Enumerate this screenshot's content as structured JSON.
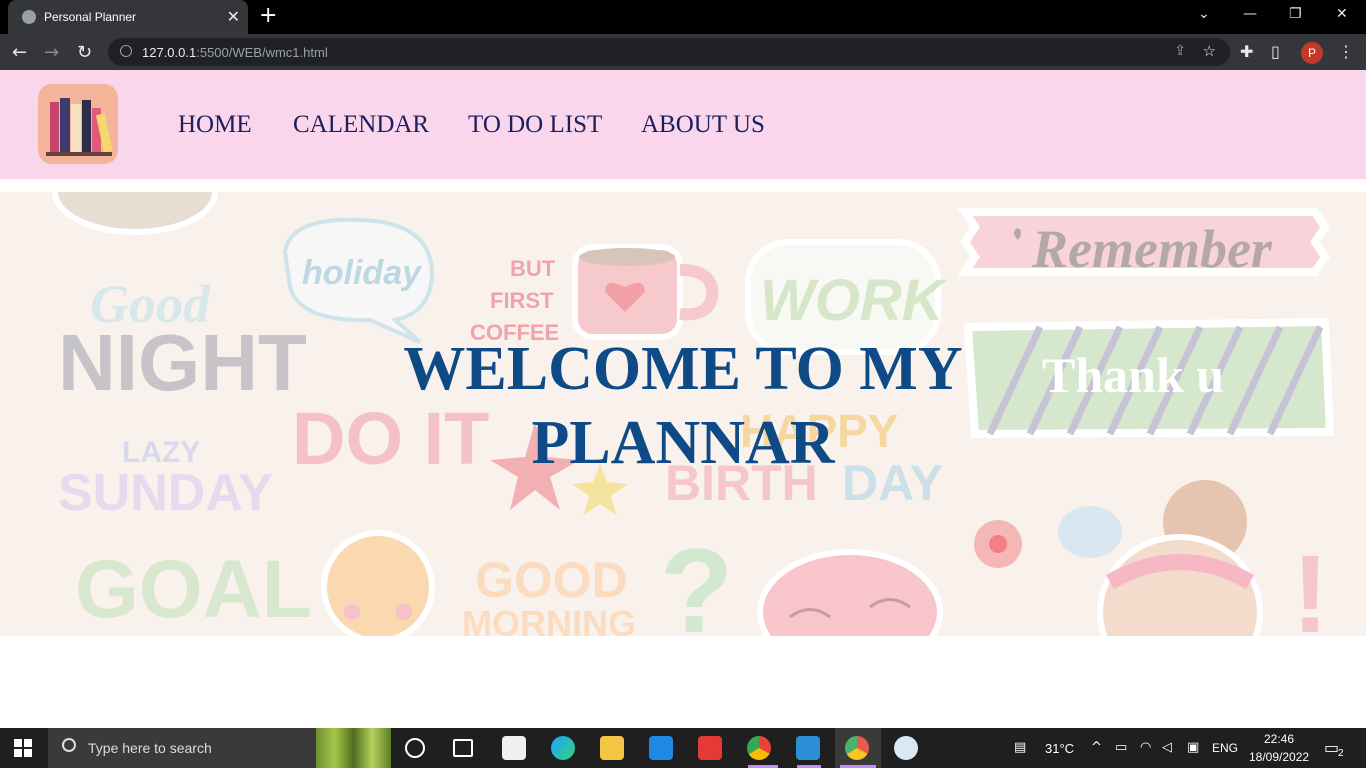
{
  "browser": {
    "tab_title": "Personal Planner",
    "tab_close": "✕",
    "new_tab": "+",
    "url_host": "127.0.0.1",
    "url_path": ":5500/WEB/wmc1.html",
    "profile_initial": "P",
    "window_controls": [
      "⌄",
      "—",
      "❐",
      "✕"
    ]
  },
  "site": {
    "nav": [
      "HOME",
      "CALENDAR",
      "TO DO LIST",
      "ABOUT US"
    ],
    "hero_line1": "WELCOME TO MY",
    "hero_line2": "PLANNAR",
    "stickers": [
      "Good",
      "NIGHT",
      "holiday",
      "BUT",
      "FIRST",
      "COFFEE",
      "WORK",
      "Remember",
      "Thank u",
      "LAZY",
      "SUNDAY",
      "DO IT",
      "HAPPY",
      "BIRTH",
      "DAY",
      "GOAL",
      "GOOD",
      "MORNING",
      "?",
      "!"
    ]
  },
  "taskbar": {
    "search_placeholder": "Type here to search",
    "weather": "31°C",
    "language": "ENG",
    "time": "22:46",
    "date": "18/09/2022",
    "notifications": "2"
  },
  "colors": {
    "header_bg": "#fad6ec",
    "nav_text": "#1b1f5e",
    "hero_text": "#0e4a86"
  }
}
